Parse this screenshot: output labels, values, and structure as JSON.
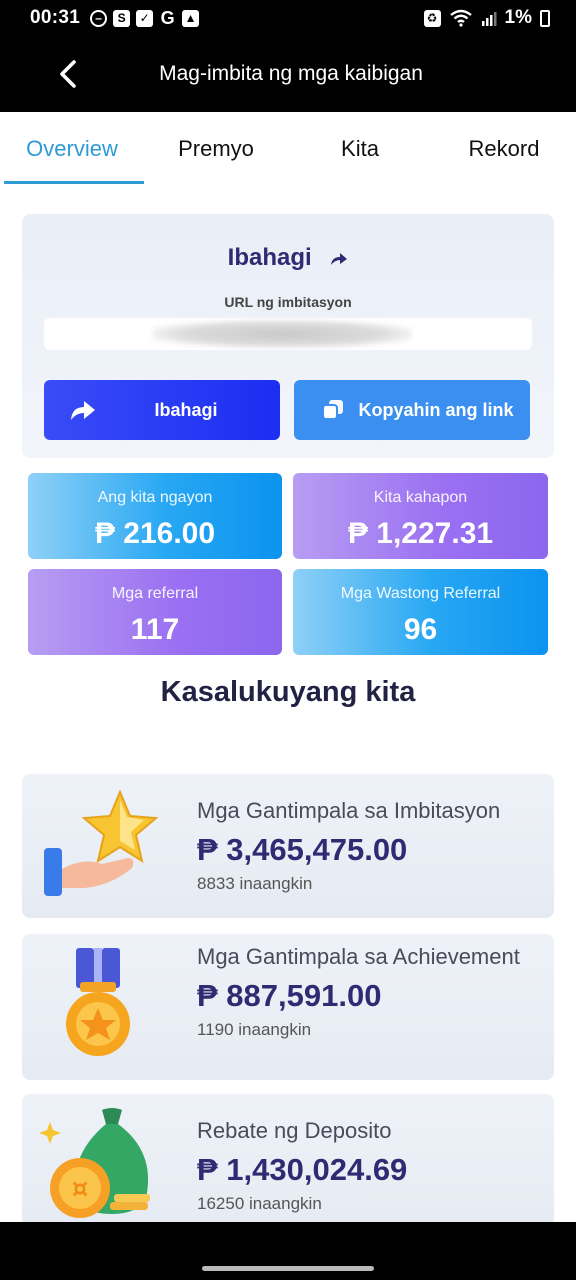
{
  "status_bar": {
    "time": "00:31",
    "battery": "1%",
    "left_icons": [
      "do-not-disturb-icon",
      "shop-icon",
      "check-icon",
      "google-icon",
      "image-icon"
    ],
    "right_icons": [
      "recycle-icon",
      "wifi-icon",
      "signal-icon",
      "battery-icon"
    ]
  },
  "header": {
    "title": "Mag-imbita ng mga kaibigan",
    "back_icon": "chevron-left-icon"
  },
  "tabs": [
    {
      "label": "Overview",
      "active": true
    },
    {
      "label": "Premyo",
      "active": false
    },
    {
      "label": "Kita",
      "active": false
    },
    {
      "label": "Rekord",
      "active": false
    }
  ],
  "share": {
    "title": "Ibahagi",
    "url_label": "URL ng imbitasyon",
    "url_value": "",
    "share_button": "Ibahagi",
    "copy_button": "Kopyahin ang link"
  },
  "stats": {
    "today": {
      "label": "Ang kita ngayon",
      "value": "₱ 216.00"
    },
    "yesterday": {
      "label": "Kita kahapon",
      "value": "₱ 1,227.31"
    },
    "referrals": {
      "label": "Mga referral",
      "value": "117"
    },
    "valid_referrals": {
      "label": "Mga Wastong Referral",
      "value": "96"
    }
  },
  "section_title": "Kasalukuyang kita",
  "rewards": [
    {
      "title": "Mga Gantimpala sa Imbitasyon",
      "amount": "₱ 3,465,475.00",
      "count": "8833 inaangkin",
      "icon": "star-hand-icon"
    },
    {
      "title": "Mga Gantimpala sa Achievement",
      "amount": "₱ 887,591.00",
      "count": "1190 inaangkin",
      "icon": "medal-icon"
    },
    {
      "title": "Rebate ng Deposito",
      "amount": "₱ 1,430,024.69",
      "count": "16250 inaangkin",
      "icon": "money-bag-icon"
    }
  ],
  "colors": {
    "accent": "#2e9bd6",
    "title_navy": "#2f2b73",
    "share_button": "#1b2ef2",
    "copy_button": "#3b8ff0",
    "stat_blue": "#0b93ef",
    "stat_purple": "#8b67ee"
  }
}
